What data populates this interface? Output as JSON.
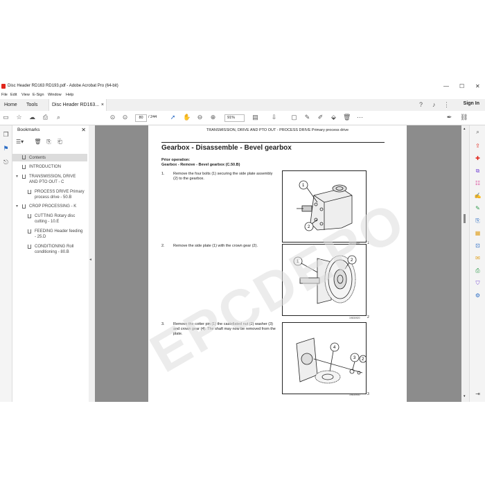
{
  "window": {
    "title": "Disc Header RD163 RD193.pdf - Adobe Acrobat Pro (64-bit)",
    "controls": [
      "—",
      "☐",
      "✕"
    ]
  },
  "menu": [
    "File",
    "Edit",
    "View",
    "E-Sign",
    "Window",
    "Help"
  ],
  "tabs": {
    "home": "Home",
    "tools": "Tools",
    "doc": "Disc Header RD163...",
    "close": "×",
    "signin": "Sign In"
  },
  "toolbar": {
    "page_current": "80",
    "page_total": "/ 244",
    "zoom": "91%"
  },
  "bookmarks": {
    "title": "Bookmarks",
    "close": "✕",
    "items": [
      {
        "label": "Contents",
        "selected": true
      },
      {
        "label": "INTRODUCTION"
      },
      {
        "label1": "TRANSMISSION, DRIVE",
        "label2": "AND PTO OUT - C"
      },
      {
        "label1": "PROCESS DRIVE Primary",
        "label2": "process drive - 50.B"
      },
      {
        "label": "CROP PROCESSING - K"
      },
      {
        "label1": "CUTTING Rotary disc",
        "label2": "cutting - 10.E"
      },
      {
        "label1": "FEEDING Header feeding",
        "label2": "- 25.D"
      },
      {
        "label1": "CONDITIONING Roll",
        "label2": "conditioning - 80.B"
      }
    ]
  },
  "page": {
    "running_header": "TRANSMISSION, DRIVE AND PTO OUT - PROCESS DRIVE Primary process drive",
    "heading": "Gearbox - Disassemble - Bevel gearbox",
    "prior_label": "Prior operation:",
    "prior_text": "Gearbox - Remove - Bevel gearbox (C.50.B)",
    "steps": [
      {
        "num": "1.",
        "text": "Remove the four bolts (1) securing the side plate assembly (2) to the gearbox.",
        "fig_id": "20110160",
        "fig_num": "1",
        "callouts": [
          "1",
          "2"
        ]
      },
      {
        "num": "2.",
        "text": "Remove the side plate (1) with the crown gear (2).",
        "fig_id": "19830920",
        "fig_num": "2",
        "callouts": [
          "1",
          "2"
        ]
      },
      {
        "num": "3.",
        "text": "Remove the cotter pin (1) the castellated nut (2) washer (3) and crown gear (4). The shaft may now be removed from the plate.",
        "fig_id": "19830930",
        "fig_num": "3",
        "callouts": [
          "4",
          "3",
          "2",
          "1"
        ]
      }
    ],
    "watermark": "EPCDEPO.COM"
  },
  "colors": {
    "accent": "#2b6cc4",
    "pdf_red": "#e1251b",
    "canvas_gray": "#8c8c8c"
  }
}
